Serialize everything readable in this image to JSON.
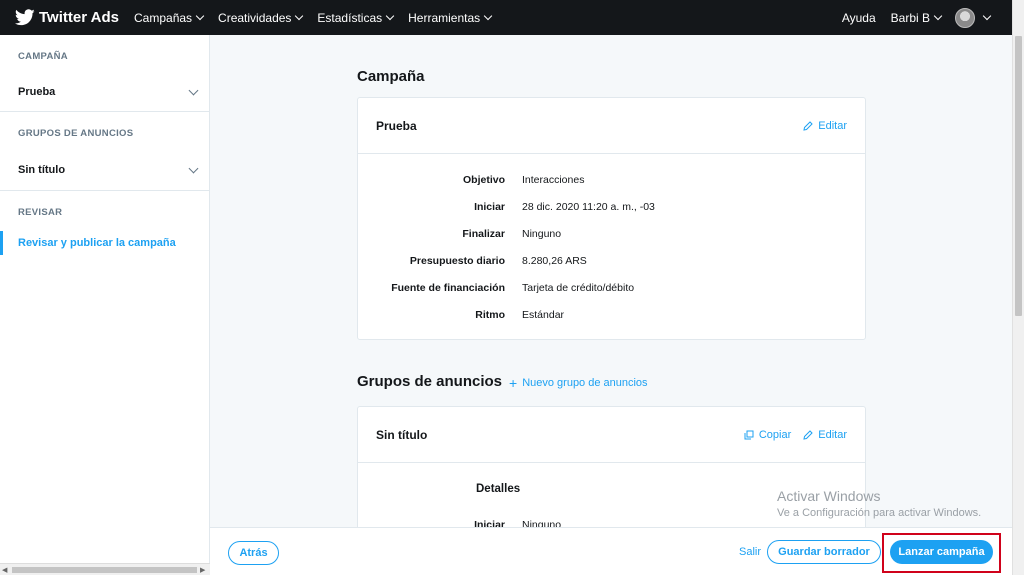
{
  "topbar": {
    "brand": "Twitter Ads",
    "nav": [
      "Campañas",
      "Creatividades",
      "Estadísticas",
      "Herramientas"
    ],
    "help": "Ayuda",
    "user": "Barbi B"
  },
  "sidebar": {
    "campaign_head": "CAMPAÑA",
    "campaign_name": "Prueba",
    "groups_head": "GRUPOS DE ANUNCIOS",
    "group_name": "Sin título",
    "review_head": "REVISAR",
    "review_item": "Revisar y publicar la campaña"
  },
  "campaign": {
    "section_title": "Campaña",
    "card_title": "Prueba",
    "edit": "Editar",
    "fields": [
      {
        "k": "Objetivo",
        "v": "Interacciones"
      },
      {
        "k": "Iniciar",
        "v": "28 dic. 2020 11:20 a. m., -03"
      },
      {
        "k": "Finalizar",
        "v": "Ninguno"
      },
      {
        "k": "Presupuesto diario",
        "v": "8.280,26 ARS"
      },
      {
        "k": "Fuente de financiación",
        "v": "Tarjeta de crédito/débito"
      },
      {
        "k": "Ritmo",
        "v": "Estándar"
      }
    ]
  },
  "groups": {
    "section_title": "Grupos de anuncios",
    "new_group": "Nuevo grupo de anuncios",
    "card_title": "Sin título",
    "copy": "Copiar",
    "edit": "Editar",
    "details_head": "Detalles",
    "fields": [
      {
        "k": "Iniciar",
        "v": "Ninguno"
      }
    ]
  },
  "watermark": {
    "line1": "Activar Windows",
    "line2": "Ve a Configuración para activar Windows."
  },
  "footer": {
    "back": "Atrás",
    "exit": "Salir",
    "save_draft": "Guardar borrador",
    "launch": "Lanzar campaña"
  },
  "colors": {
    "accent": "#1da1f2",
    "topbar": "#14171a",
    "highlight": "#d0021b"
  }
}
